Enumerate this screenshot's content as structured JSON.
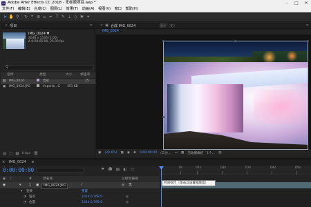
{
  "window": {
    "title": "Adobe After Effects CC 2018 - 无标题项目.aep *",
    "app_icon": "Ae",
    "controls": [
      "minimize-icon",
      "maximize-icon",
      "close-icon"
    ]
  },
  "menu": [
    "文件(F)",
    "编辑(E)",
    "合成(C)",
    "图层(L)",
    "效果(T)",
    "动画(A)",
    "视图(V)",
    "窗口",
    "帮助(H)"
  ],
  "toolbar": {
    "tools": [
      "selection-tool-icon",
      "hand-tool-icon",
      "zoom-tool-icon",
      "rotate-tool-icon",
      "camera-tool-icon",
      "pan-behind-tool-icon",
      "mask-tool-icon",
      "pen-tool-icon",
      "text-tool-icon",
      "brush-tool-icon",
      "clone-stamp-tool-icon",
      "eraser-tool-icon",
      "roto-brush-tool-icon",
      "puppet-tool-icon"
    ]
  },
  "project": {
    "tab_label": "项目",
    "thumb_name": "IMG_0024 ▼",
    "thumb_details": [
      "2048 x 1536 (1.00)",
      "Δ 0:00:05:00, 25.00 fps"
    ],
    "columns": {
      "name": "名称",
      "type": "类型",
      "size": "大小",
      "rate": "帧速率"
    },
    "items": [
      {
        "name": "IMG_0024",
        "type": "合成",
        "size": "",
        "rate": "25",
        "color": "#b0a0d0",
        "selected": true
      },
      {
        "name": "IMG_0024.JPG",
        "type": "Importe...G",
        "size": "451 KB",
        "rate": "",
        "color": "#a8a8a8",
        "selected": false
      }
    ],
    "bit_depth": "8 bpc"
  },
  "composition": {
    "tab_label": "合成 IMG_0024",
    "chip_label": "IMG_0024",
    "layers_tab": "图层（无）",
    "footer": {
      "zoom": "(20.6%)",
      "resolution": "(三分...",
      "camera": "活动摄像机",
      "views": "1个..."
    }
  },
  "timeline": {
    "tab_label": "IMG_0024",
    "timecode": "0:00:00:00",
    "ruler_labels": [
      "0s",
      "01s",
      "02s",
      "03s",
      "04s",
      "05s"
    ],
    "layer_columns": {
      "name": "源名称",
      "mode": "父级和链接"
    },
    "layer": {
      "index": "1",
      "name": "IMG_0024.JPG",
      "parent": "无"
    },
    "props": [
      {
        "name": "变换",
        "value": "重置"
      },
      {
        "name": "锚点",
        "value": "1024.0,768.0"
      },
      {
        "name": "位置",
        "value": "1024.0,768.0"
      }
    ],
    "tooltip": "时间标尺（单击以设置缩放度）"
  },
  "colors": {
    "accent": "#4d8ff0",
    "panel": "#232323",
    "titlebar": "#f0f0f0"
  }
}
